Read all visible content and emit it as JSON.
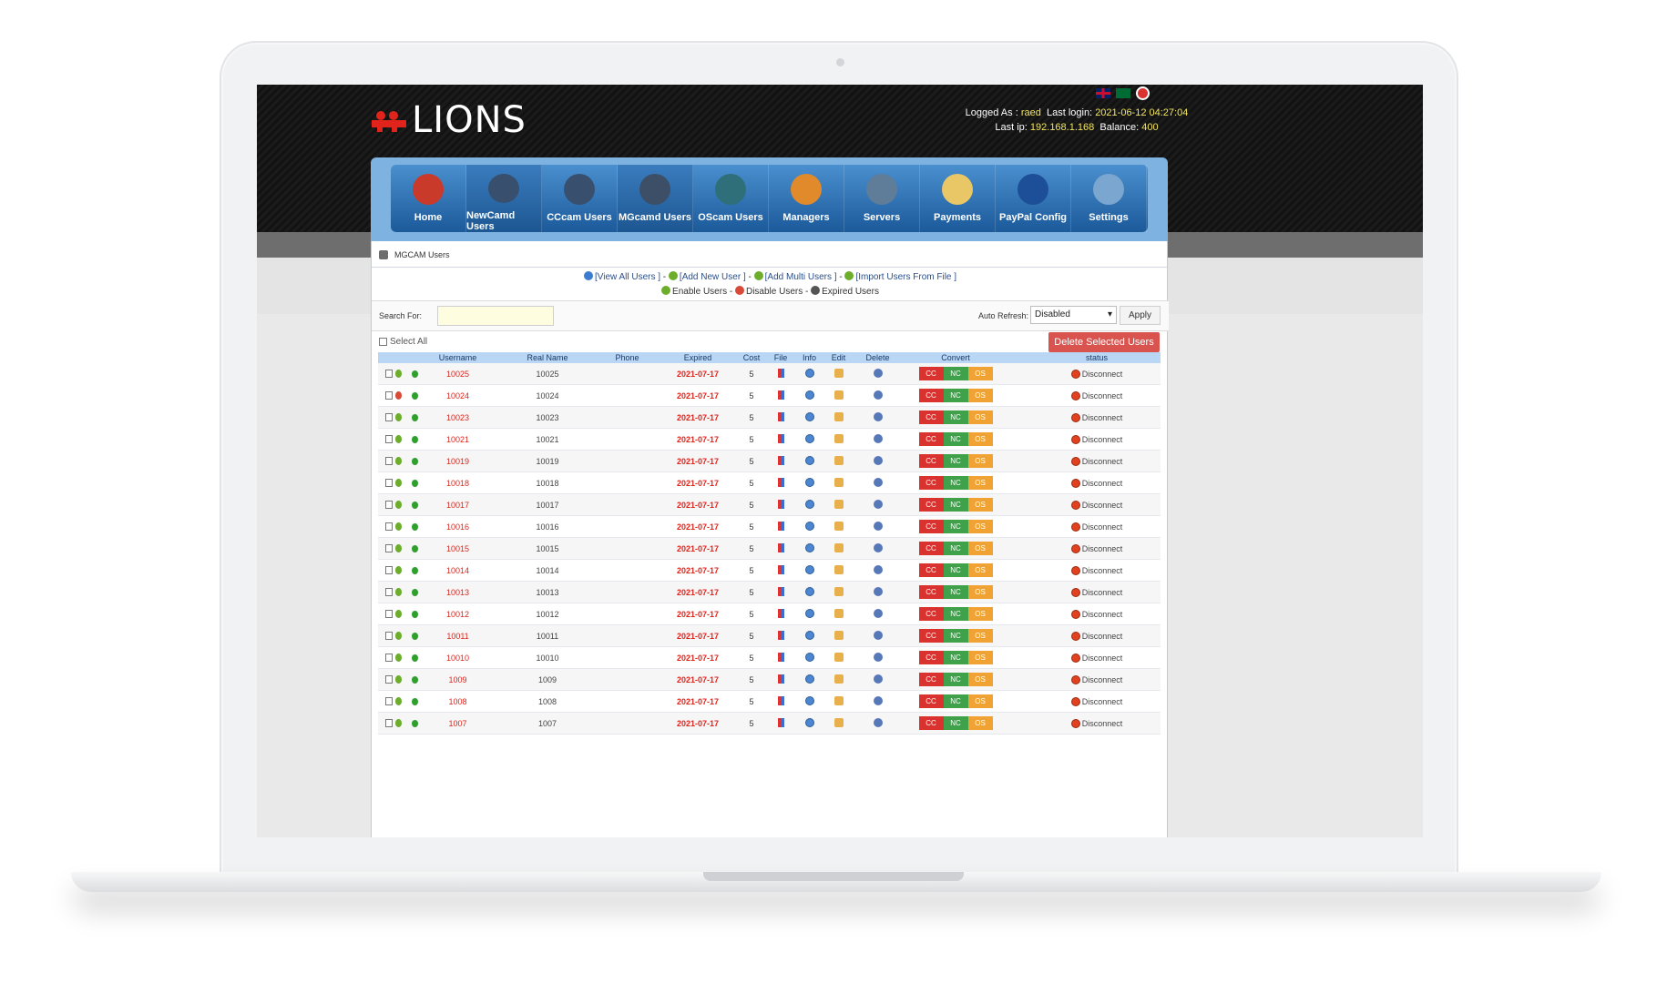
{
  "header": {
    "logo_text": "LIONS",
    "logged_as_label": "Logged As :",
    "logged_as_user": "raed",
    "last_login_label": "Last login:",
    "last_login_value": "2021-06-12 04:27:04",
    "last_ip_label": "Last ip:",
    "last_ip_value": "192.168.1.168",
    "balance_label": "Balance:",
    "balance_value": "400"
  },
  "nav": {
    "items": [
      {
        "label": "Home",
        "icon": "home-icon",
        "active": false
      },
      {
        "label": "NewCamd Users",
        "icon": "satellite-icon",
        "active": true
      },
      {
        "label": "CCcam Users",
        "icon": "satellite-icon",
        "active": false
      },
      {
        "label": "MGcamd Users",
        "icon": "dish-icon",
        "active": true
      },
      {
        "label": "OScam Users",
        "icon": "ufo-icon",
        "active": false
      },
      {
        "label": "Managers",
        "icon": "manager-icon",
        "active": false
      },
      {
        "label": "Servers",
        "icon": "server-icon",
        "active": false
      },
      {
        "label": "Payments",
        "icon": "invoice-icon",
        "active": false
      },
      {
        "label": "PayPal Config",
        "icon": "paypal-icon",
        "active": false
      },
      {
        "label": "Settings",
        "icon": "tools-icon",
        "active": false
      }
    ]
  },
  "breadcrumb": "MGCAM Users",
  "actions": {
    "view_all": "[View All Users ]",
    "add_new": "[Add New User ]",
    "add_multi": "[Add Multi Users ]",
    "import": "[Import Users From File ]",
    "sep": "-",
    "enable": "Enable Users",
    "disable": "Disable Users",
    "expired": "Expired Users"
  },
  "search": {
    "label": "Search For:",
    "auto_refresh_label": "Auto Refresh:",
    "auto_refresh_value": "Disabled",
    "apply_label": "Apply"
  },
  "select_all_label": "Select All",
  "delete_selected_label": "Delete Selected Users",
  "table": {
    "headers": [
      "Username",
      "Real Name",
      "Phone",
      "Expired",
      "Cost",
      "File",
      "Info",
      "Edit",
      "Delete",
      "Convert",
      "status"
    ],
    "convert_labels": [
      "CC",
      "NC",
      "OS"
    ],
    "status_label": "Disconnect",
    "rows": [
      {
        "username": "10025",
        "real_name": "10025",
        "phone": "",
        "expired": "2021-07-17",
        "cost": "5",
        "user_icon": "enabled"
      },
      {
        "username": "10024",
        "real_name": "10024",
        "phone": "",
        "expired": "2021-07-17",
        "cost": "5",
        "user_icon": "disabled"
      },
      {
        "username": "10023",
        "real_name": "10023",
        "phone": "",
        "expired": "2021-07-17",
        "cost": "5",
        "user_icon": "enabled"
      },
      {
        "username": "10021",
        "real_name": "10021",
        "phone": "",
        "expired": "2021-07-17",
        "cost": "5",
        "user_icon": "enabled"
      },
      {
        "username": "10019",
        "real_name": "10019",
        "phone": "",
        "expired": "2021-07-17",
        "cost": "5",
        "user_icon": "enabled"
      },
      {
        "username": "10018",
        "real_name": "10018",
        "phone": "",
        "expired": "2021-07-17",
        "cost": "5",
        "user_icon": "enabled"
      },
      {
        "username": "10017",
        "real_name": "10017",
        "phone": "",
        "expired": "2021-07-17",
        "cost": "5",
        "user_icon": "enabled"
      },
      {
        "username": "10016",
        "real_name": "10016",
        "phone": "",
        "expired": "2021-07-17",
        "cost": "5",
        "user_icon": "enabled"
      },
      {
        "username": "10015",
        "real_name": "10015",
        "phone": "",
        "expired": "2021-07-17",
        "cost": "5",
        "user_icon": "enabled"
      },
      {
        "username": "10014",
        "real_name": "10014",
        "phone": "",
        "expired": "2021-07-17",
        "cost": "5",
        "user_icon": "enabled"
      },
      {
        "username": "10013",
        "real_name": "10013",
        "phone": "",
        "expired": "2021-07-17",
        "cost": "5",
        "user_icon": "enabled"
      },
      {
        "username": "10012",
        "real_name": "10012",
        "phone": "",
        "expired": "2021-07-17",
        "cost": "5",
        "user_icon": "enabled"
      },
      {
        "username": "10011",
        "real_name": "10011",
        "phone": "",
        "expired": "2021-07-17",
        "cost": "5",
        "user_icon": "enabled"
      },
      {
        "username": "10010",
        "real_name": "10010",
        "phone": "",
        "expired": "2021-07-17",
        "cost": "5",
        "user_icon": "enabled"
      },
      {
        "username": "1009",
        "real_name": "1009",
        "phone": "",
        "expired": "2021-07-17",
        "cost": "5",
        "user_icon": "enabled"
      },
      {
        "username": "1008",
        "real_name": "1008",
        "phone": "",
        "expired": "2021-07-17",
        "cost": "5",
        "user_icon": "enabled"
      },
      {
        "username": "1007",
        "real_name": "1007",
        "phone": "",
        "expired": "2021-07-17",
        "cost": "5",
        "user_icon": "enabled"
      }
    ]
  },
  "colors": {
    "header_bg": "#141414",
    "nav_blue": "#1c5a9a",
    "username_red": "#e0241b",
    "delete_btn": "#d9534f",
    "cc": "#d9322f",
    "nc": "#3fa14a",
    "os": "#f0a333"
  }
}
